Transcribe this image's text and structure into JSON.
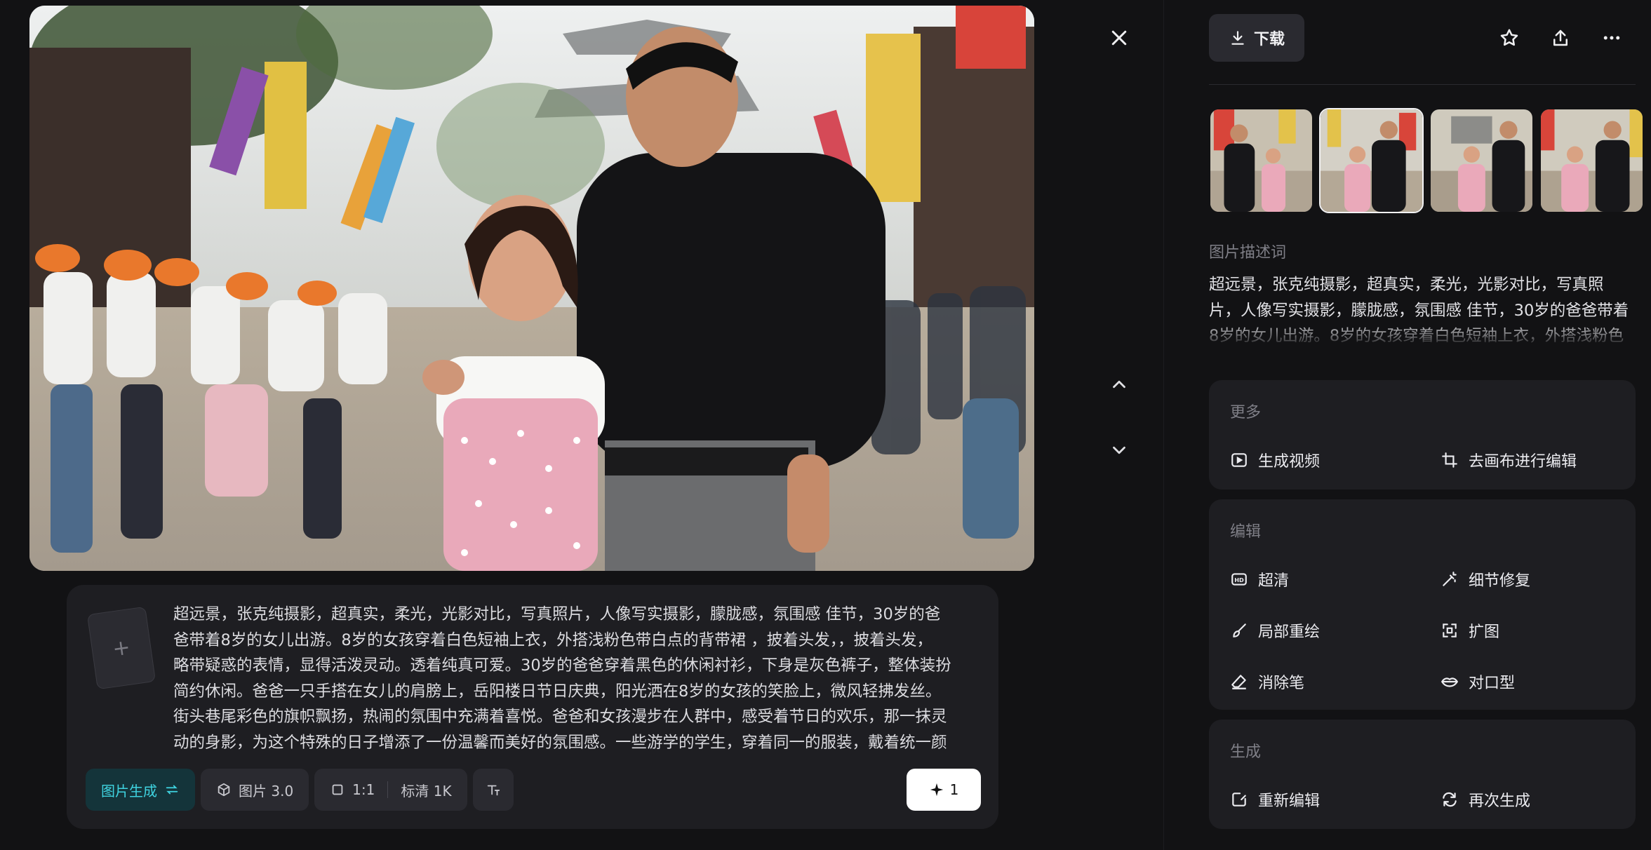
{
  "prompt": {
    "lines": [
      "超远景，张克纯摄影，超真实，柔光，光影对比，写真照片，人像写实摄影，朦胧感，氛围感 佳节，30岁的爸",
      "爸带着8岁的女儿出游。8岁的女孩穿着白色短袖上衣，外搭浅粉色带白点的背带裙 ，披着头发，，披着头发，",
      "略带疑惑的表情，显得活泼灵动。透着纯真可爱。30岁的爸爸穿着黑色的休闲衬衫，下身是灰色裤子，整体装扮",
      "简约休闲。爸爸一只手搭在女儿的肩膀上，岳阳楼日节日庆典，阳光洒在8岁的女孩的笑脸上，微风轻拂发丝。",
      "街头巷尾彩色的旗帜飘扬，热闹的氛围中充满着喜悦。爸爸和女孩漫步在人群中，感受着节日的欢乐，那一抹灵",
      "动的身影，为这个特殊的日子增添了一份温馨而美好的氛围感。一些游学的学生，穿着同一的服装，戴着统一颜"
    ],
    "add_symbol": "+"
  },
  "toolbar": {
    "mode_label": "图片生成",
    "mode_icon": "swap-icon",
    "model_label": "图片 3.0",
    "ratio_label": "1:1",
    "quality_label": "标清 1K",
    "generate_count": "1"
  },
  "header": {
    "download_label": "下载"
  },
  "description": {
    "label": "图片描述词",
    "lines": [
      "超远景，张克纯摄影，超真实，柔光，光影对比，写真照",
      "片，人像写实摄影，朦胧感，氛围感 佳节，30岁的爸爸带着",
      "8岁的女儿出游。8岁的女孩穿着白色短袖上衣，外搭浅粉色"
    ]
  },
  "sections": {
    "more": {
      "title": "更多",
      "actions": [
        "生成视频",
        "去画布进行编辑"
      ]
    },
    "edit": {
      "title": "编辑",
      "actions": [
        "超清",
        "细节修复",
        "局部重绘",
        "扩图",
        "消除笔",
        "对口型"
      ]
    },
    "generate": {
      "title": "生成",
      "actions": [
        "重新编辑",
        "再次生成"
      ]
    }
  },
  "colors": {
    "background": "#121214",
    "card": "#1e1e22",
    "accent": "#3fd3e0",
    "accent_bg": "#14343a"
  },
  "thumbnails": {
    "selected_index": 1
  }
}
